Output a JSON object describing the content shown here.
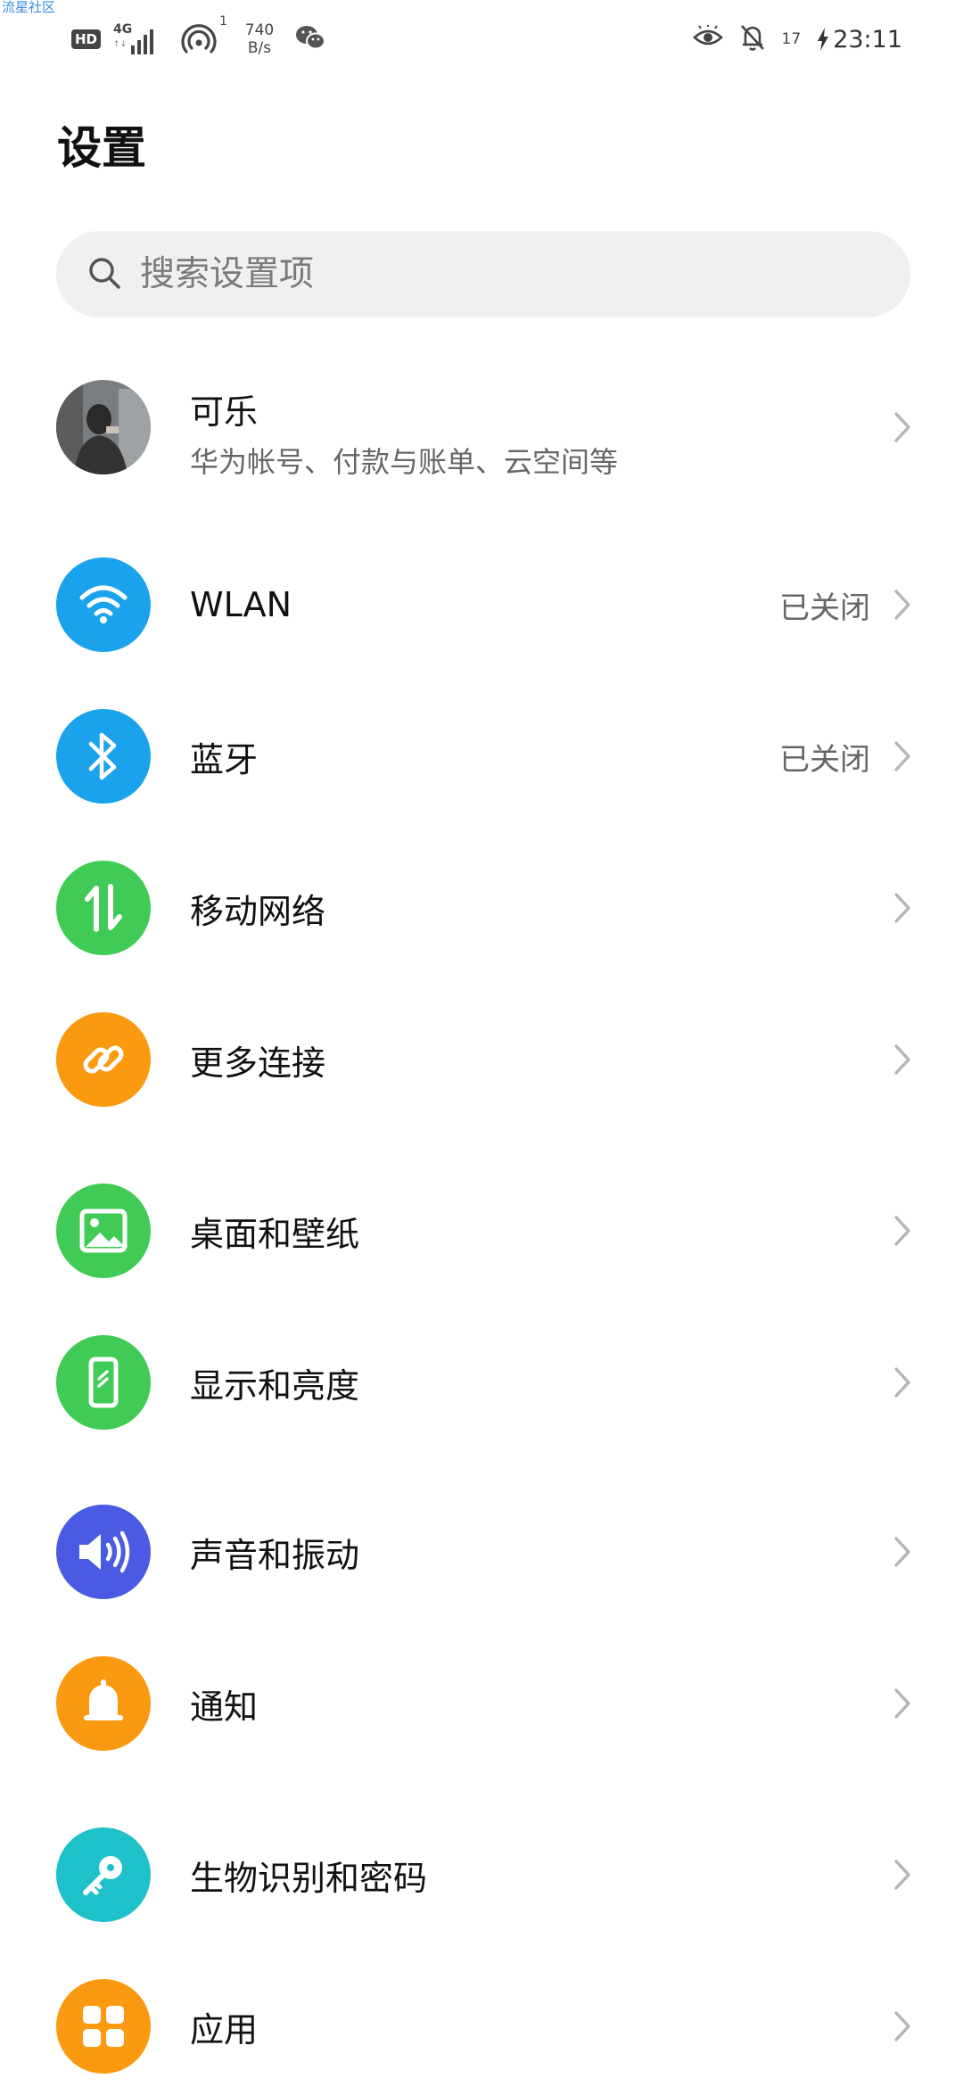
{
  "watermark": "流星社区",
  "status_bar": {
    "left_icons": [
      "hd-icon",
      "4g-signal-icon",
      "hotspot-icon",
      "wechat-icon"
    ],
    "hd": "HD",
    "network": "4G",
    "hotspot_count": "1",
    "speed_value": "740",
    "speed_unit": "B/s",
    "right_icons": [
      "eye-comfort-icon",
      "notification-muted-icon",
      "charging-icon"
    ],
    "battery": "17",
    "time": "23:11"
  },
  "page_title": "设置",
  "search": {
    "placeholder": "搜索设置项",
    "icon": "search-icon"
  },
  "account": {
    "name": "可乐",
    "subtitle": "华为帐号、付款与账单、云空间等"
  },
  "items": [
    {
      "label": "WLAN",
      "value": "已关闭",
      "icon": "wifi-icon",
      "color": "#1aa3ec"
    },
    {
      "label": "蓝牙",
      "value": "已关闭",
      "icon": "bluetooth-icon",
      "color": "#1aa3ec"
    },
    {
      "label": "移动网络",
      "value": "",
      "icon": "mobile-data-icon",
      "color": "#3fcb55"
    },
    {
      "label": "更多连接",
      "value": "",
      "icon": "link-icon",
      "color": "#fb9a10"
    },
    {
      "label": "桌面和壁纸",
      "value": "",
      "icon": "wallpaper-icon",
      "color": "#3fcb55"
    },
    {
      "label": "显示和亮度",
      "value": "",
      "icon": "display-icon",
      "color": "#3fcb55"
    },
    {
      "label": "声音和振动",
      "value": "",
      "icon": "sound-icon",
      "color": "#4a5ae3"
    },
    {
      "label": "通知",
      "value": "",
      "icon": "bell-icon",
      "color": "#fb9a10"
    },
    {
      "label": "生物识别和密码",
      "value": "",
      "icon": "key-icon",
      "color": "#1ec1c9"
    },
    {
      "label": "应用",
      "value": "",
      "icon": "apps-icon",
      "color": "#fb9a10"
    }
  ]
}
